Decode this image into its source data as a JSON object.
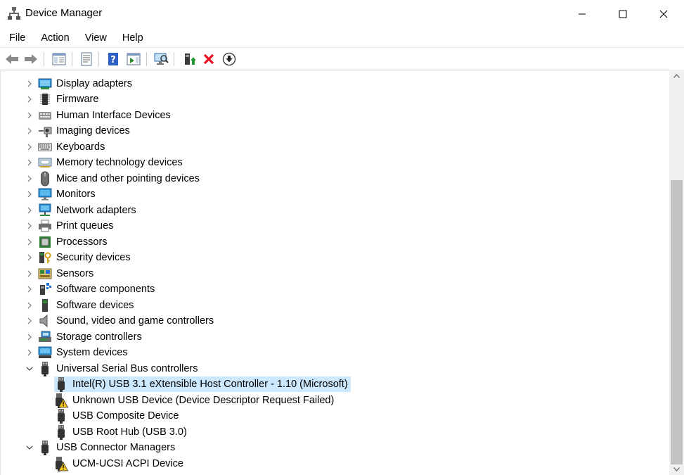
{
  "window": {
    "title": "Device Manager"
  },
  "menu": [
    "File",
    "Action",
    "View",
    "Help"
  ],
  "tree": {
    "categories": [
      {
        "label": "Display adapters",
        "icon": "display-adapter-icon"
      },
      {
        "label": "Firmware",
        "icon": "firmware-icon"
      },
      {
        "label": "Human Interface Devices",
        "icon": "hid-icon"
      },
      {
        "label": "Imaging devices",
        "icon": "camera-icon"
      },
      {
        "label": "Keyboards",
        "icon": "keyboard-icon"
      },
      {
        "label": "Memory technology devices",
        "icon": "memory-icon"
      },
      {
        "label": "Mice and other pointing devices",
        "icon": "mouse-icon"
      },
      {
        "label": "Monitors",
        "icon": "monitor-icon"
      },
      {
        "label": "Network adapters",
        "icon": "network-icon"
      },
      {
        "label": "Print queues",
        "icon": "printer-icon"
      },
      {
        "label": "Processors",
        "icon": "processor-icon"
      },
      {
        "label": "Security devices",
        "icon": "security-icon"
      },
      {
        "label": "Sensors",
        "icon": "sensor-icon"
      },
      {
        "label": "Software components",
        "icon": "software-component-icon"
      },
      {
        "label": "Software devices",
        "icon": "software-device-icon"
      },
      {
        "label": "Sound, video and game controllers",
        "icon": "speaker-icon"
      },
      {
        "label": "Storage controllers",
        "icon": "storage-icon"
      },
      {
        "label": "System devices",
        "icon": "system-icon"
      }
    ],
    "usb": {
      "label": "Universal Serial Bus controllers",
      "children": [
        {
          "label": "Intel(R) USB 3.1 eXtensible Host Controller - 1.10 (Microsoft)",
          "selected": true,
          "warning": false
        },
        {
          "label": "Unknown USB Device (Device Descriptor Request Failed)",
          "selected": false,
          "warning": true
        },
        {
          "label": "USB Composite Device",
          "selected": false,
          "warning": false
        },
        {
          "label": "USB Root Hub (USB 3.0)",
          "selected": false,
          "warning": false
        }
      ]
    },
    "ucm": {
      "label": "USB Connector Managers",
      "children": [
        {
          "label": "UCM-UCSI ACPI Device",
          "selected": false,
          "warning": true
        }
      ]
    }
  },
  "colors": {
    "selection": "#cce8ff",
    "warning": "#f5c518",
    "error_red": "#e81123",
    "accent_blue": "#1e6fd9"
  }
}
